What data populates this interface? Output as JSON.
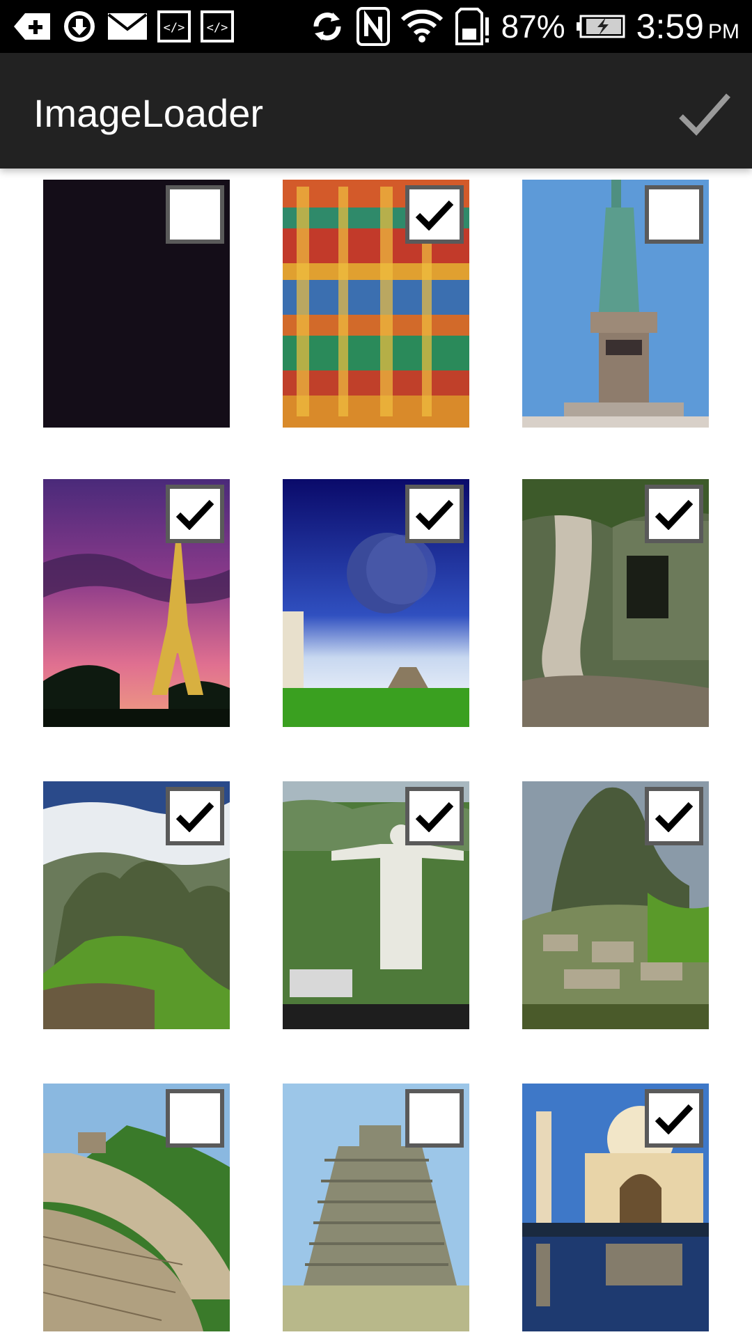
{
  "status_bar": {
    "left_icons": [
      "add-notification-icon",
      "sync-download-icon",
      "mail-icon",
      "code-icon",
      "code-icon"
    ],
    "right_icons": [
      "sync-icon",
      "nfc-icon",
      "wifi-icon",
      "sd-card-alert-icon"
    ],
    "battery_percent": "87%",
    "battery_charging": true,
    "time": "3:59",
    "ampm": "PM"
  },
  "action_bar": {
    "title": "ImageLoader",
    "done_icon": "checkmark-icon"
  },
  "colors": {
    "action_bar_bg": "#222222",
    "status_bar_bg": "#000000",
    "checkbox_border": "#5a5a5a"
  },
  "images": [
    {
      "name": "dark-night-image",
      "checked": false
    },
    {
      "name": "temple-gopuram-image",
      "checked": true
    },
    {
      "name": "statue-of-liberty-image",
      "checked": false
    },
    {
      "name": "eiffel-tower-image",
      "checked": true
    },
    {
      "name": "wonders-collage-image",
      "checked": true
    },
    {
      "name": "ta-prohm-ruins-image",
      "checked": true
    },
    {
      "name": "machu-picchu-clouds-image",
      "checked": true
    },
    {
      "name": "christ-the-redeemer-image",
      "checked": true
    },
    {
      "name": "machu-picchu-image",
      "checked": true
    },
    {
      "name": "great-wall-image",
      "checked": false
    },
    {
      "name": "chichen-itza-image",
      "checked": false
    },
    {
      "name": "taj-mahal-image",
      "checked": true
    }
  ]
}
